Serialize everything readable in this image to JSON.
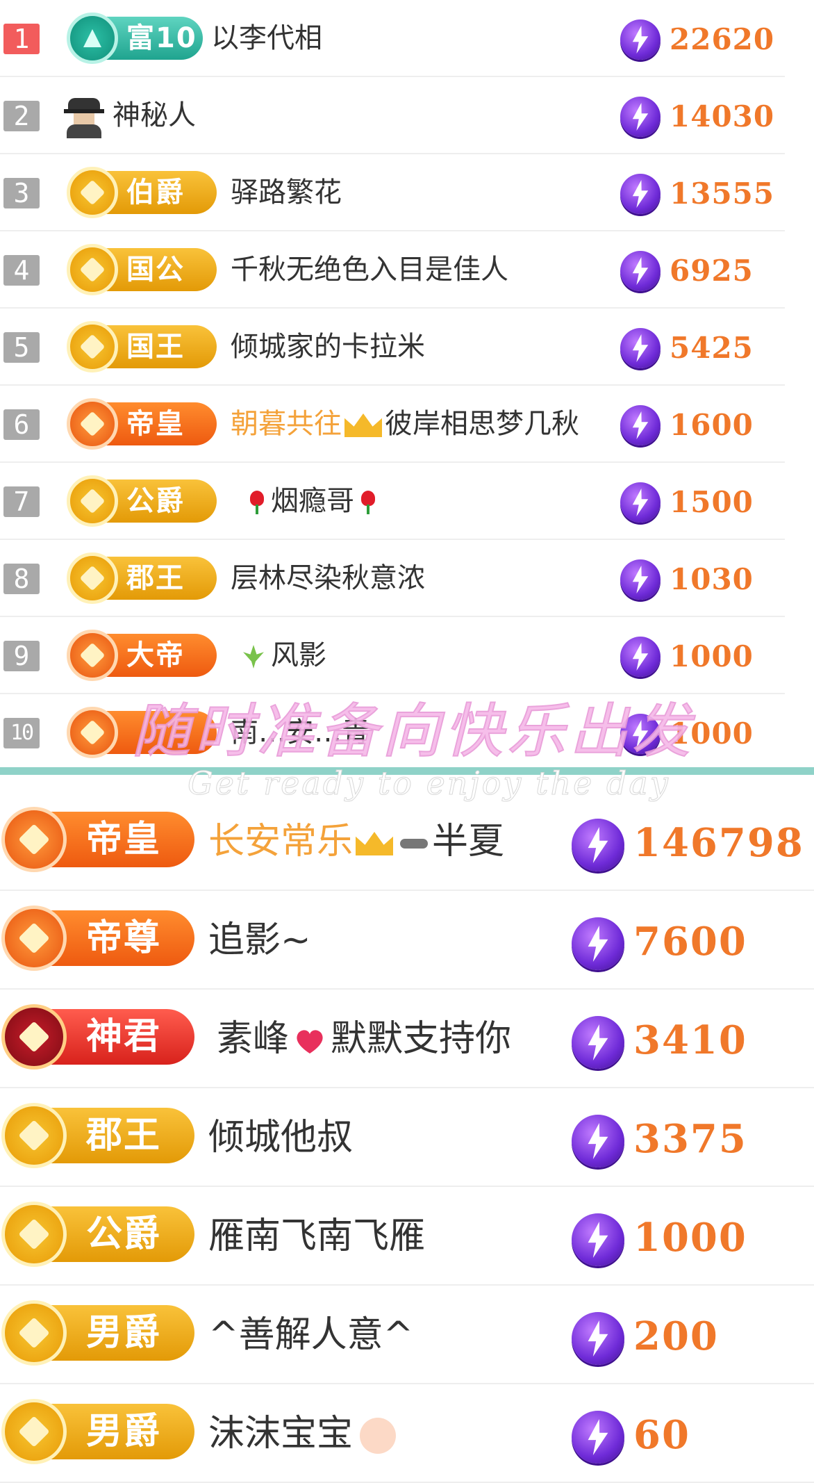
{
  "top_list": [
    {
      "rank": "1",
      "badge": {
        "label": "富10",
        "style": "teal"
      },
      "name_parts": [
        {
          "text": "以李代相"
        }
      ],
      "score": "22620"
    },
    {
      "rank": "2",
      "badge": null,
      "name_parts": [
        {
          "text": "神秘人"
        }
      ],
      "score": "14030"
    },
    {
      "rank": "3",
      "badge": {
        "label": "伯爵",
        "style": "gold"
      },
      "name_parts": [
        {
          "text": "驿路繁花"
        }
      ],
      "score": "13555"
    },
    {
      "rank": "4",
      "badge": {
        "label": "国公",
        "style": "gold"
      },
      "name_parts": [
        {
          "text": "千秋无绝色入目是佳人"
        }
      ],
      "score": "6925"
    },
    {
      "rank": "5",
      "badge": {
        "label": "国王",
        "style": "gold"
      },
      "name_parts": [
        {
          "text": "倾城家的卡拉米"
        }
      ],
      "score": "5425"
    },
    {
      "rank": "6",
      "badge": {
        "label": "帝皇",
        "style": "orange"
      },
      "name_parts": [
        {
          "text": "朝暮共往",
          "hl": true
        },
        {
          "icon": "crown-icon"
        },
        {
          "text": "彼岸相思梦几秋"
        }
      ],
      "score": "1600"
    },
    {
      "rank": "7",
      "badge": {
        "label": "公爵",
        "style": "gold"
      },
      "name_parts": [
        {
          "icon": "rose-icon"
        },
        {
          "text": "烟瘾哥"
        },
        {
          "icon": "rose-icon"
        }
      ],
      "score": "1500"
    },
    {
      "rank": "8",
      "badge": {
        "label": "郡王",
        "style": "gold"
      },
      "name_parts": [
        {
          "text": "层林尽染秋意浓"
        }
      ],
      "score": "1030"
    },
    {
      "rank": "9",
      "badge": {
        "label": "大帝",
        "style": "orange"
      },
      "name_parts": [
        {
          "icon": "leaf-icon"
        },
        {
          "text": "风影"
        }
      ],
      "score": "1000"
    },
    {
      "rank": "10",
      "badge": {
        "label": "",
        "style": "orange"
      },
      "name_parts": [
        {
          "text": "南…安…青"
        }
      ],
      "score": "1000"
    }
  ],
  "watermark": {
    "cn": "随时准备向快乐出发",
    "en": "Get ready to enjoy the day"
  },
  "bottom_list": [
    {
      "badge": {
        "label": "帝皇",
        "style": "orange"
      },
      "name_parts": [
        {
          "text": "长安常乐",
          "hl": true
        },
        {
          "icon": "crown-icon"
        },
        {
          "icon": "key-icon"
        },
        {
          "text": "半夏"
        }
      ],
      "score": "146798"
    },
    {
      "badge": {
        "label": "帝尊",
        "style": "orange"
      },
      "name_parts": [
        {
          "text": "追影~"
        }
      ],
      "score": "7600"
    },
    {
      "badge": {
        "label": "神君",
        "style": "red"
      },
      "name_parts": [
        {
          "text": " 素峰"
        },
        {
          "icon": "heart-icon"
        },
        {
          "text": "默默支持你"
        }
      ],
      "score": "3410"
    },
    {
      "badge": {
        "label": "郡王",
        "style": "gold"
      },
      "name_parts": [
        {
          "text": "倾城他叔"
        }
      ],
      "score": "3375"
    },
    {
      "badge": {
        "label": "公爵",
        "style": "gold"
      },
      "name_parts": [
        {
          "text": "雁南飞南飞雁"
        }
      ],
      "score": "1000"
    },
    {
      "badge": {
        "label": "男爵",
        "style": "gold"
      },
      "name_parts": [
        {
          "text": "^善解人意^"
        }
      ],
      "score": "200"
    },
    {
      "badge": {
        "label": "男爵",
        "style": "gold"
      },
      "name_parts": [
        {
          "text": "沫沫宝宝"
        },
        {
          "icon": "baby-icon"
        }
      ],
      "score": "60"
    }
  ]
}
